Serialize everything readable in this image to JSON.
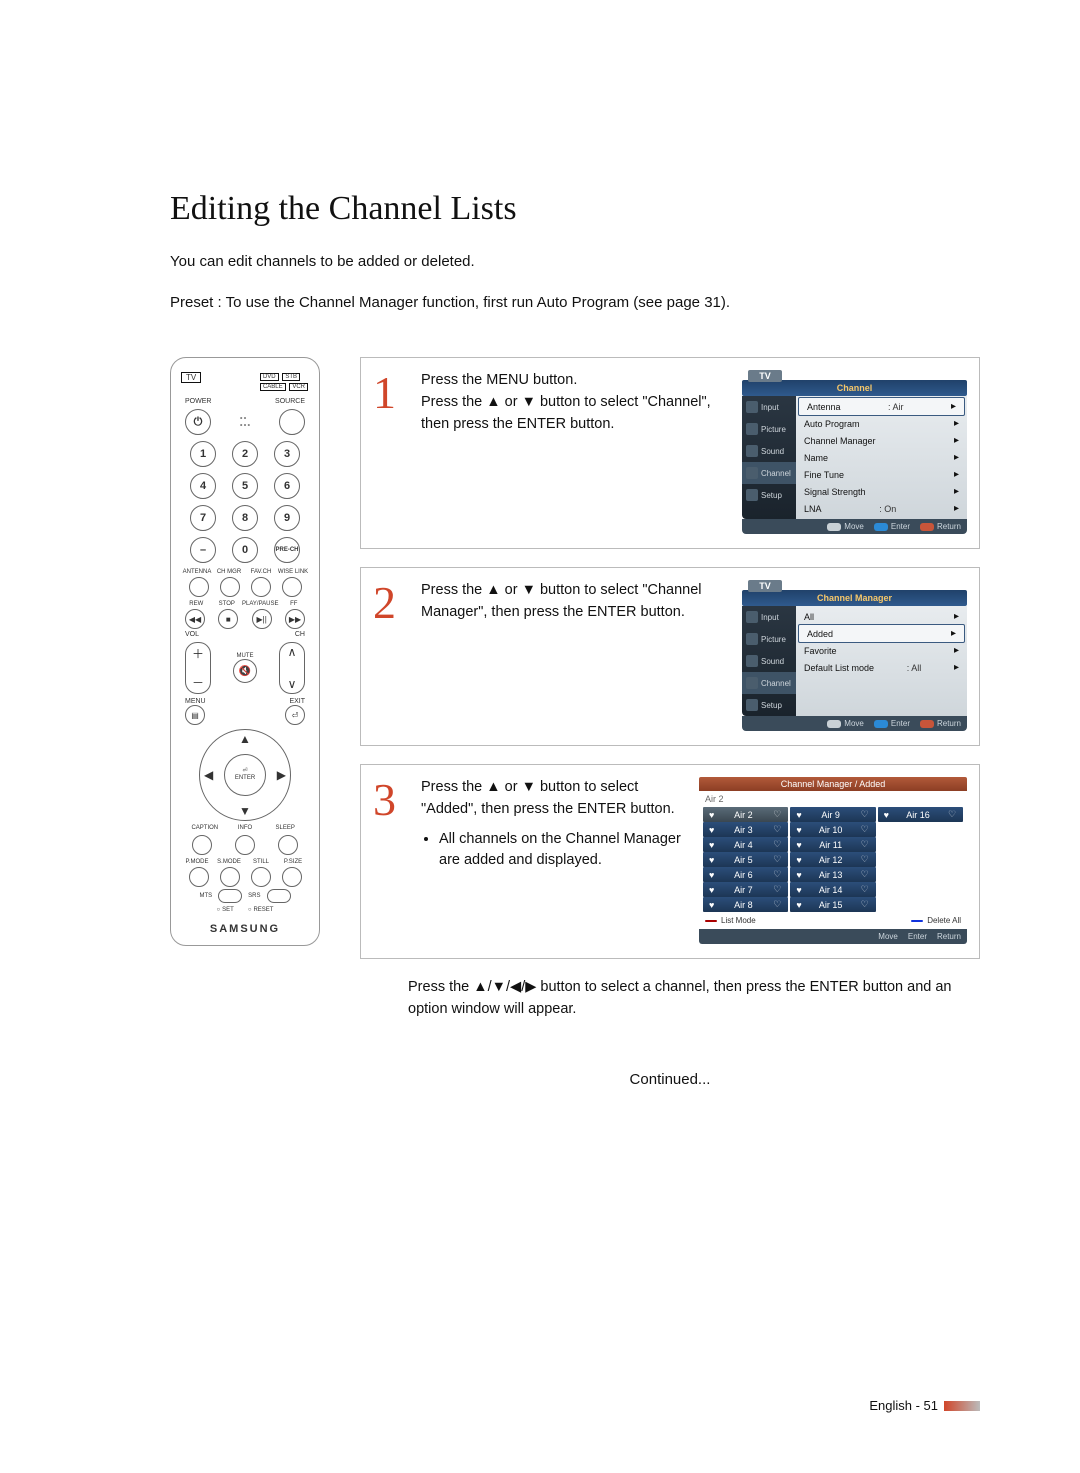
{
  "title": "Editing the Channel Lists",
  "intro1": "You can edit channels to be added or deleted.",
  "intro2": "Preset : To use the Channel Manager function, first run Auto Program (see page 31).",
  "remote": {
    "tv": "TV",
    "dvd": "DVD",
    "stb": "STB",
    "cable": "CABLE",
    "vcr": "VCR",
    "power": "POWER",
    "source": "SOURCE",
    "nums": [
      "1",
      "2",
      "3",
      "4",
      "5",
      "6",
      "7",
      "8",
      "9",
      "0"
    ],
    "dash": "–",
    "prech": "PRE-CH",
    "row4": [
      "ANTENNA",
      "CH MGR",
      "FAV.CH",
      "WISE LINK"
    ],
    "transport": [
      "REW",
      "STOP",
      "PLAY/PAUSE",
      "FF"
    ],
    "t_glyph": [
      "◀◀",
      "■",
      "▶||",
      "▶▶"
    ],
    "vol": "VOL",
    "ch": "CH",
    "mute": "MUTE",
    "menu": "MENU",
    "exit": "EXIT",
    "enter": "ENTER",
    "row_cis": [
      "CAPTION",
      "INFO",
      "SLEEP"
    ],
    "row_pm": [
      "P.MODE",
      "S.MODE",
      "STILL",
      "P.SIZE"
    ],
    "mts": "MTS",
    "srs": "SRS",
    "set": "SET",
    "reset": "RESET",
    "brand": "SAMSUNG"
  },
  "steps": {
    "s1": {
      "num": "1",
      "text": "Press the MENU button.\nPress the ▲ or ▼ button to select \"Channel\", then press the ENTER button."
    },
    "s2": {
      "num": "2",
      "text": "Press the ▲ or ▼ button to select \"Channel Manager\", then press the ENTER button."
    },
    "s3": {
      "num": "3",
      "text": "Press the ▲ or ▼ button to select \"Added\", then press the ENTER button.",
      "bullet": "All channels on the Channel Manager are added and displayed."
    },
    "after3": "Press the ▲/▼/◀/▶ button to select a channel, then press the ENTER button and an option window will appear."
  },
  "osd1": {
    "tv": "TV",
    "title": "Channel",
    "tabs": [
      "Input",
      "Picture",
      "Sound",
      "Channel",
      "Setup"
    ],
    "opts": [
      {
        "label": "Antenna",
        "val": ": Air",
        "sel": true
      },
      {
        "label": "Auto Program"
      },
      {
        "label": "Channel Manager"
      },
      {
        "label": "Name"
      },
      {
        "label": "Fine Tune"
      },
      {
        "label": "Signal Strength"
      },
      {
        "label": "LNA",
        "val": ": On"
      }
    ],
    "hints": [
      "Move",
      "Enter",
      "Return"
    ]
  },
  "osd2": {
    "tv": "TV",
    "title": "Channel Manager",
    "tabs": [
      "Input",
      "Picture",
      "Sound",
      "Channel",
      "Setup"
    ],
    "opts": [
      {
        "label": "All"
      },
      {
        "label": "Added",
        "sel": true
      },
      {
        "label": "Favorite"
      },
      {
        "label": "Default List mode",
        "val": ": All"
      }
    ],
    "hints": [
      "Move",
      "Enter",
      "Return"
    ]
  },
  "chwin": {
    "bar": "Channel Manager / Added",
    "current": "Air 2",
    "col1": [
      "Air 2",
      "Air 3",
      "Air 4",
      "Air 5",
      "Air 6",
      "Air 7",
      "Air 8"
    ],
    "col2": [
      "Air 9",
      "Air 10",
      "Air 11",
      "Air 12",
      "Air 13",
      "Air 14",
      "Air 15"
    ],
    "col3": [
      "Air 16"
    ],
    "listmode": "List Mode",
    "deleteall": "Delete All",
    "hints": [
      "Move",
      "Enter",
      "Return"
    ]
  },
  "continued": "Continued...",
  "pagenum": "English - 51"
}
